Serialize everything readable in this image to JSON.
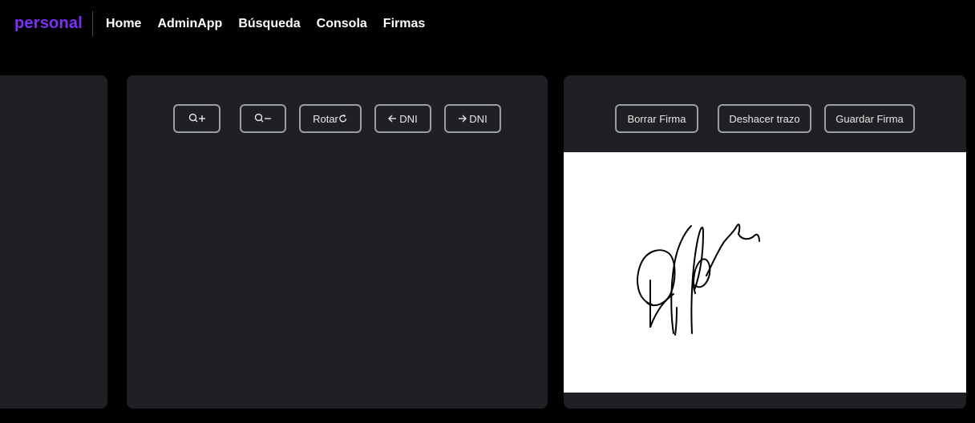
{
  "brand": {
    "name": "personal",
    "color": "#7b2ff7"
  },
  "nav": {
    "items": [
      {
        "label": "Home"
      },
      {
        "label": "AdminApp"
      },
      {
        "label": "Búsqueda"
      },
      {
        "label": "Consola"
      },
      {
        "label": "Firmas"
      }
    ]
  },
  "viewer_toolbar": {
    "zoom_in_icon": "magnifier-plus-icon",
    "zoom_out_icon": "magnifier-minus-icon",
    "rotate_label": "Rotar",
    "rotate_icon": "rotate-clockwise-icon",
    "prev_label": "DNI",
    "prev_icon": "arrow-left-icon",
    "next_label": "DNI",
    "next_icon": "arrow-right-icon"
  },
  "signature_toolbar": {
    "clear_label": "Borrar Firma",
    "undo_label": "Deshacer trazo",
    "save_label": "Guardar Firma"
  },
  "colors": {
    "background": "#000000",
    "panel": "#1f2024",
    "button_border": "#9a9da3",
    "canvas": "#ffffff",
    "ink": "#000000"
  }
}
